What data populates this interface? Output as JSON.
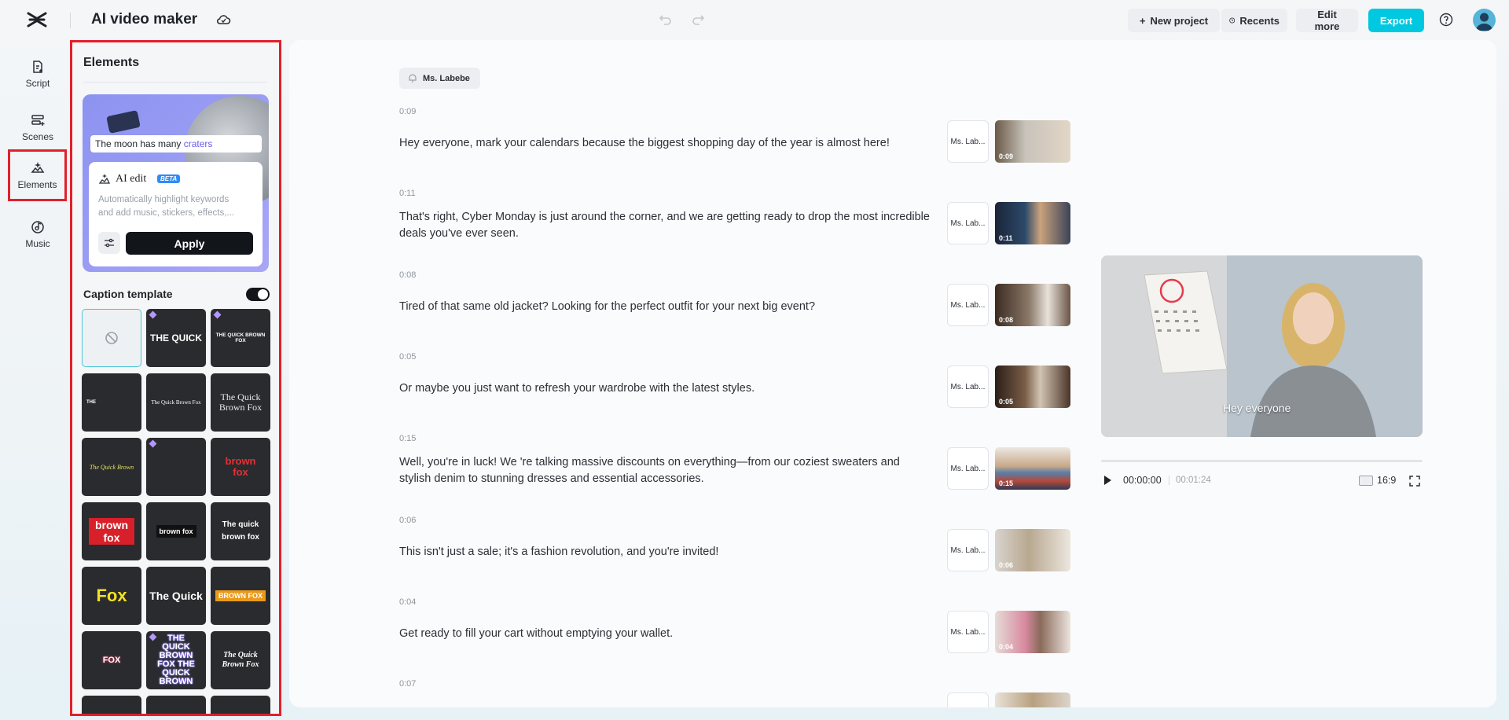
{
  "header": {
    "app_title": "AI video maker",
    "new_project": "New project",
    "recents": "Recents",
    "edit_more": "Edit more",
    "export": "Export"
  },
  "nav": {
    "items": [
      {
        "label": "Script",
        "icon": "script-icon"
      },
      {
        "label": "Scenes",
        "icon": "scenes-icon"
      },
      {
        "label": "Elements",
        "icon": "elements-icon",
        "active": true
      },
      {
        "label": "Music",
        "icon": "music-icon"
      }
    ]
  },
  "panel": {
    "title": "Elements",
    "demo_caption_prefix": "The moon has many ",
    "demo_caption_highlight": "craters",
    "ai_edit_label": "AI edit",
    "beta_label": "BETA",
    "ai_desc_line1": "Automatically highlight keywords",
    "ai_desc_line2": "and add music, stickers, effects,...",
    "apply": "Apply",
    "caption_template_label": "Caption template",
    "caption_template_enabled": true,
    "templates": [
      {
        "text": "",
        "none": true
      },
      {
        "text": "THE QUICK",
        "premium": true
      },
      {
        "text": "THE QUICK BROWN FOX",
        "premium": true
      },
      {
        "text": "THE"
      },
      {
        "text": "The Quick Brown Fox"
      },
      {
        "text": "The Quick Brown Fox"
      },
      {
        "text": "The Quick Brown"
      },
      {
        "text": "",
        "premium": true
      },
      {
        "text": "brown fox"
      },
      {
        "text": "brown fox"
      },
      {
        "text": "brown fox"
      },
      {
        "text": "The quick brown fox"
      },
      {
        "text": "Fox"
      },
      {
        "text": "The Quick"
      },
      {
        "text": "BROWN FOX"
      },
      {
        "text": "FOX"
      },
      {
        "text": "THE QUICK BROWN FOX THE QUICK BROWN",
        "premium": true
      },
      {
        "text": "The Quick Brown Fox"
      },
      {
        "text": ""
      },
      {
        "text": ""
      },
      {
        "text": ""
      }
    ]
  },
  "script": {
    "speaker_chip": "Ms. Labebe",
    "scenes": [
      {
        "time": "0:09",
        "text": "Hey everyone, mark your calendars because the biggest shopping day of the year is almost here!",
        "voice": "Ms. Lab...",
        "thumb_dur": "0:09"
      },
      {
        "time": "0:11",
        "text": "That's right, Cyber Monday is just around the corner, and we are getting ready to drop the most incredible deals you've ever seen.",
        "voice": "Ms. Lab...",
        "thumb_dur": "0:11"
      },
      {
        "time": "0:08",
        "text": "Tired of that same old jacket? Looking for the perfect outfit for your next big event?",
        "voice": "Ms. Lab...",
        "thumb_dur": "0:08"
      },
      {
        "time": "0:05",
        "text": "Or maybe you just want to refresh your wardrobe with the latest styles.",
        "voice": "Ms. Lab...",
        "thumb_dur": "0:05"
      },
      {
        "time": "0:15",
        "text": "Well, you're in luck! We 're talking massive discounts on everything—from our coziest sweaters and stylish denim to stunning dresses and essential accessories.",
        "voice": "Ms. Lab...",
        "thumb_dur": "0:15"
      },
      {
        "time": "0:06",
        "text": "This isn't just a sale; it's a fashion revolution, and you're invited!",
        "voice": "Ms. Lab...",
        "thumb_dur": "0:06"
      },
      {
        "time": "0:04",
        "text": "Get ready to fill your cart without emptying your wallet.",
        "voice": "Ms. Lab...",
        "thumb_dur": "0:04"
      },
      {
        "time": "0:07",
        "text": "",
        "voice": "",
        "thumb_dur": ""
      }
    ]
  },
  "preview": {
    "caption": "Hey everyone",
    "current_time": "00:00:00",
    "total_time": "00:01:24",
    "aspect_ratio": "16:9",
    "progress": 0
  },
  "colors": {
    "accent": "#00c8e0",
    "highlight_border": "#e0202a"
  }
}
